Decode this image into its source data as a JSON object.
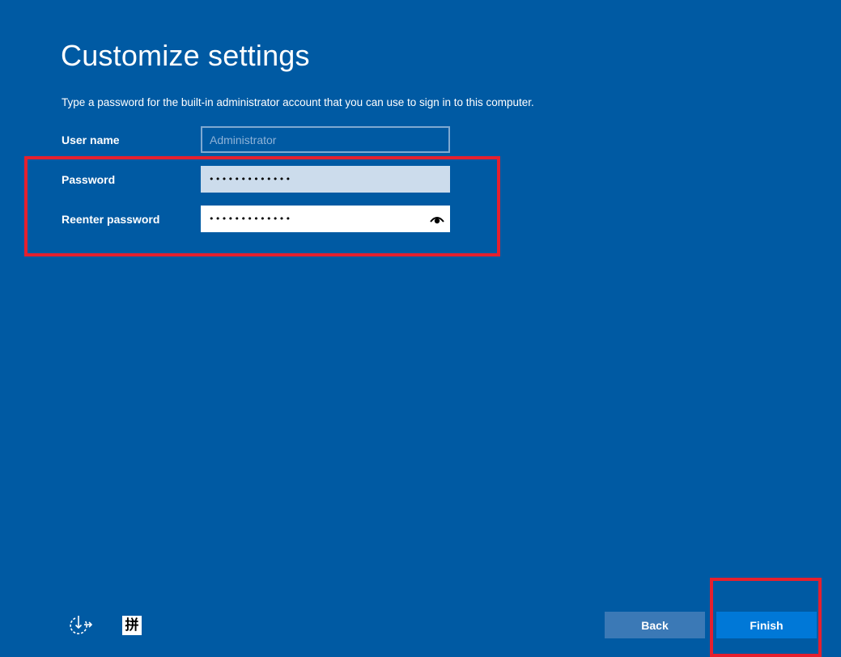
{
  "page": {
    "title": "Customize settings",
    "instructions": "Type a password for the built-in administrator account that you can use to sign in to this computer."
  },
  "form": {
    "username_label": "User name",
    "username_placeholder": "Administrator",
    "password_label": "Password",
    "password_masked": "•••••••••••••",
    "reenter_label": "Reenter password",
    "reenter_masked": "•••••••••••••"
  },
  "buttons": {
    "back": "Back",
    "finish": "Finish"
  },
  "taskbar": {
    "ime_glyph": "拼"
  },
  "icons": {
    "reveal": "eye-icon",
    "ease_of_access": "ease-of-access-icon",
    "ime": "ime-pinyin-icon"
  },
  "colors": {
    "background": "#005aa3",
    "finish_button": "#0078d7",
    "back_button": "#3b79b6",
    "highlight": "#e5202e"
  }
}
